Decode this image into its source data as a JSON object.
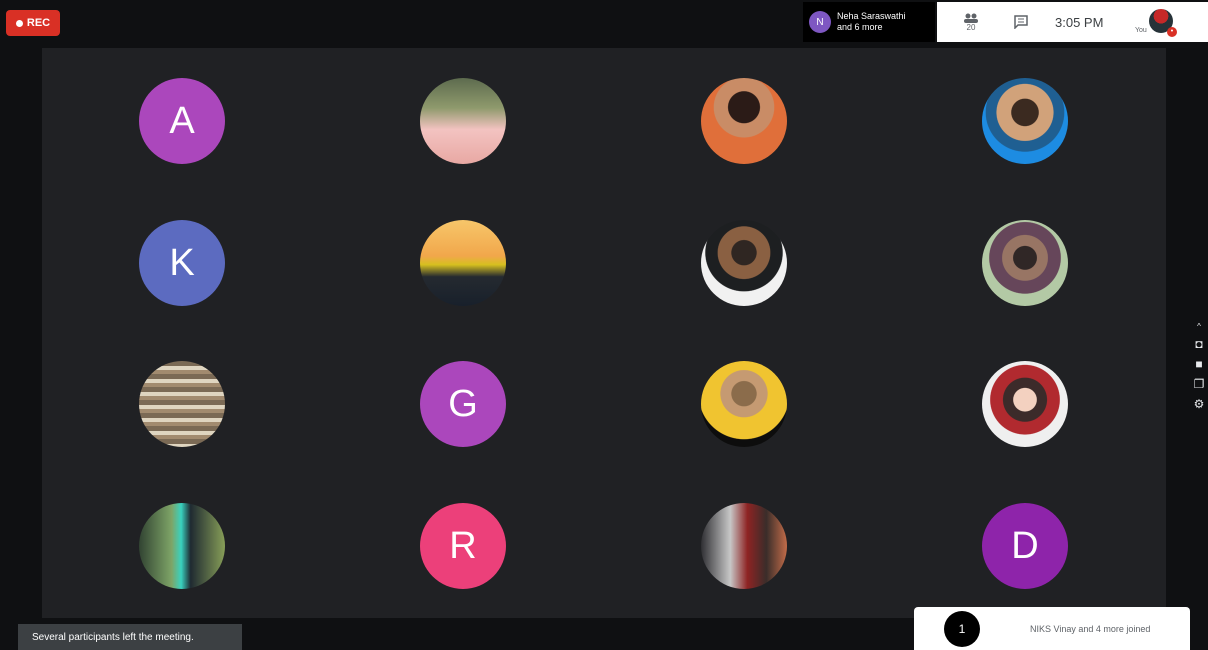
{
  "recording": {
    "label": "REC"
  },
  "presence": {
    "initial": "N",
    "line1": "Neha Saraswathi",
    "line2": "and 6 more"
  },
  "controls": {
    "people_count": "20",
    "clock": "3:05 PM",
    "me_label": "You",
    "me_badge": "•"
  },
  "participants": [
    {
      "type": "letter",
      "letter": "A",
      "color": "#ab47bc"
    },
    {
      "type": "photo",
      "name": "participant-photo-woman-pink-dress"
    },
    {
      "type": "photo",
      "name": "participant-photo-woman-orange-top"
    },
    {
      "type": "photo",
      "name": "participant-photo-man-blue-background"
    },
    {
      "type": "letter",
      "letter": "K",
      "color": "#5c6bc0"
    },
    {
      "type": "photo",
      "name": "participant-photo-yellow-sports-car"
    },
    {
      "type": "photo",
      "name": "participant-photo-man-white-background"
    },
    {
      "type": "photo",
      "name": "participant-photo-man-outdoors"
    },
    {
      "type": "photo",
      "name": "participant-photo-stacked-books"
    },
    {
      "type": "letter",
      "letter": "G",
      "color": "#ab47bc"
    },
    {
      "type": "photo",
      "name": "participant-photo-woman-yellow-dress"
    },
    {
      "type": "photo",
      "name": "participant-photo-cartoon-girl-hat"
    },
    {
      "type": "photo",
      "name": "participant-photo-man-outdoor-green"
    },
    {
      "type": "letter",
      "letter": "R",
      "color": "#ec407a"
    },
    {
      "type": "photo",
      "name": "participant-photo-man-red-wall"
    },
    {
      "type": "letter",
      "letter": "D",
      "color": "#8e24aa"
    }
  ],
  "notice": {
    "text": "Several participants left the meeting."
  },
  "join_toast": {
    "avatar": "1",
    "text": "NIKS Vinay and 4 more joined"
  }
}
